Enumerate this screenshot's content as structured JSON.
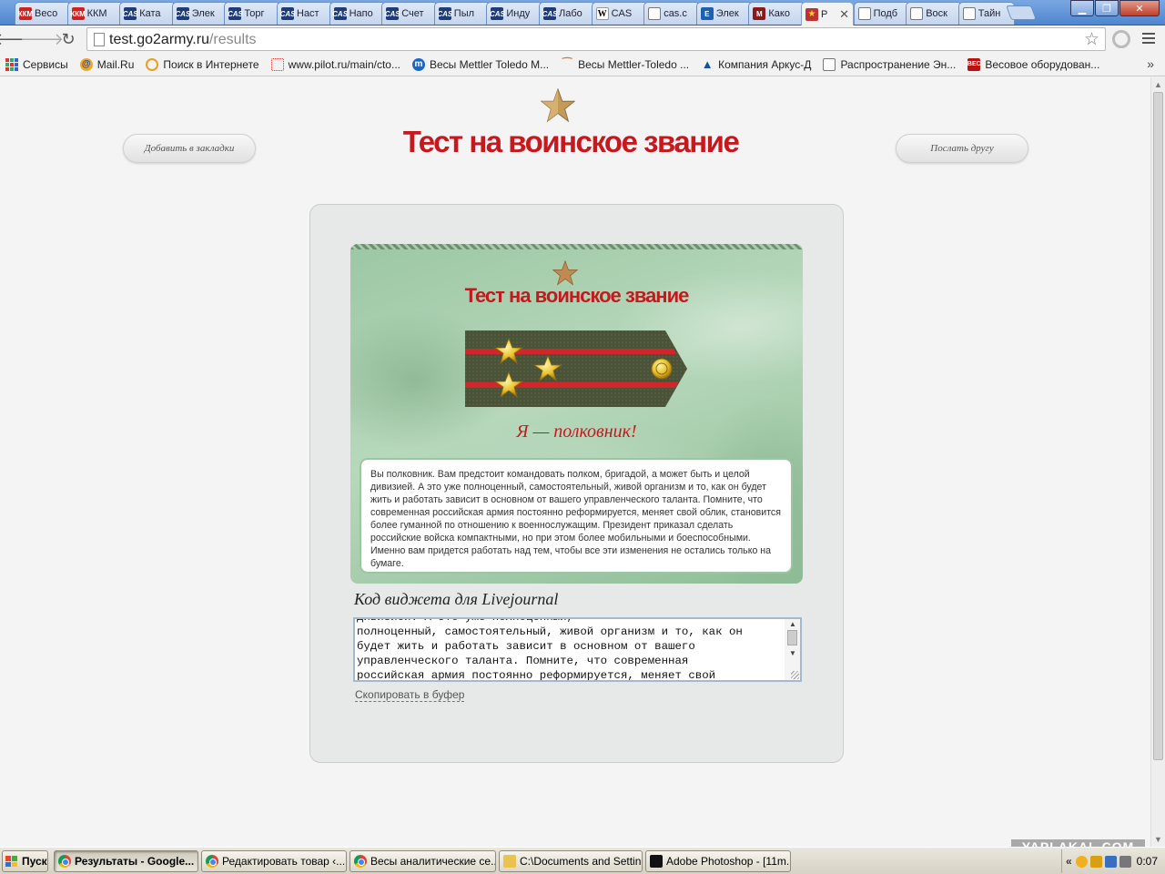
{
  "browser": {
    "tabs": [
      {
        "label": "Весо",
        "icon": "kkm-favicon"
      },
      {
        "label": "ККМ",
        "icon": "kkm-favicon"
      },
      {
        "label": "Ката",
        "icon": "cas-favicon"
      },
      {
        "label": "Элек",
        "icon": "cas-favicon"
      },
      {
        "label": "Торг",
        "icon": "cas-favicon"
      },
      {
        "label": "Наст",
        "icon": "cas-favicon"
      },
      {
        "label": "Напо",
        "icon": "cas-favicon"
      },
      {
        "label": "Счет",
        "icon": "cas-favicon"
      },
      {
        "label": "Пыл",
        "icon": "cas-favicon"
      },
      {
        "label": "Инду",
        "icon": "cas-favicon"
      },
      {
        "label": "Лабо",
        "icon": "cas-favicon"
      },
      {
        "label": "CAS",
        "icon": "wikipedia-favicon"
      },
      {
        "label": "cas.c",
        "icon": "document-favicon"
      },
      {
        "label": "Элек",
        "icon": "e-favicon"
      },
      {
        "label": "Како",
        "icon": "mp-favicon"
      },
      {
        "label": "Р",
        "icon": "star-favicon",
        "active": true
      },
      {
        "label": "Подб",
        "icon": "document-favicon"
      },
      {
        "label": "Воск",
        "icon": "document-favicon"
      },
      {
        "label": "Тайн",
        "icon": "document-favicon"
      }
    ],
    "fav_text": {
      "kkm": "ККМ",
      "cas": "CAS",
      "wiki": "W",
      "e": "E",
      "mp": "M",
      "star": "★"
    },
    "url_host": "test.go2army.ru",
    "url_path": "/results",
    "bookmarks": [
      {
        "label": "Сервисы",
        "icon": "apps-icon"
      },
      {
        "label": "Mail.Ru",
        "icon": "mailru-icon"
      },
      {
        "label": "Поиск в Интернете",
        "icon": "search-icon"
      },
      {
        "label": "www.pilot.ru/main/cto...",
        "icon": "pilot-icon"
      },
      {
        "label": "Весы Mettler Toledo M...",
        "icon": "m-icon"
      },
      {
        "label": "Весы Mettler-Toledo ...",
        "icon": "mettler-icon"
      },
      {
        "label": "Компания Аркус-Д",
        "icon": "arkus-icon"
      },
      {
        "label": "Распространение Эн...",
        "icon": "document-icon"
      },
      {
        "label": "Весовое оборудован...",
        "icon": "ves-icon"
      }
    ],
    "bookmark_more": "»"
  },
  "page": {
    "header_title": "Тест на воинское звание",
    "bookmark_button": "Добавить в закладки",
    "send_friend_button": "Послать другу",
    "card": {
      "title": "Тест на воинское звание",
      "rank_text": "Я — полковник!",
      "description": "Вы полковник. Вам предстоит командовать полком, бригадой, а может быть и целой дивизией. А это уже полноценный, самостоятельный, живой организм и то, как он будет жить и работать зависит в основном от вашего управленческого таланта. Помните, что современная российская армия постоянно реформируется, меняет свой облик, становится более гуманной по отношению к военнослужащим. Президент приказал сделать российские войска компактными, но при этом более мобильными и боеспособными. Именно вам придется работать над тем, чтобы все эти изменения не остались только на бумаге."
    },
    "widget_label": "Код виджета для Livejournal",
    "widget_code": "дивизией. А это уже полноценный,\nполноценный, самостоятельный, живой организм и то, как он\nбудет жить и работать зависит в основном от вашего\nуправленческого таланта. Помните, что современная\nроссийская армия постоянно реформируется, меняет свой",
    "copy_link": "Скопировать в буфер"
  },
  "watermark": "YAPLAKAL.COM",
  "taskbar": {
    "start": "Пуск",
    "items": [
      {
        "label": "Результаты - Google...",
        "icon": "chrome-icon",
        "active": true
      },
      {
        "label": "Редактировать товар ‹...",
        "icon": "chrome-icon"
      },
      {
        "label": "Весы аналитические се...",
        "icon": "chrome-icon"
      },
      {
        "label": "C:\\Documents and Settin...",
        "icon": "folder-icon"
      },
      {
        "label": "Adobe Photoshop - [11m...",
        "icon": "photoshop-icon"
      }
    ],
    "tray_chevron": "«",
    "clock": "0:07"
  },
  "colors": {
    "accent_red": "#c41a1f",
    "card_green": "#9cc7a4",
    "tab_blue": "#4f86cf"
  }
}
